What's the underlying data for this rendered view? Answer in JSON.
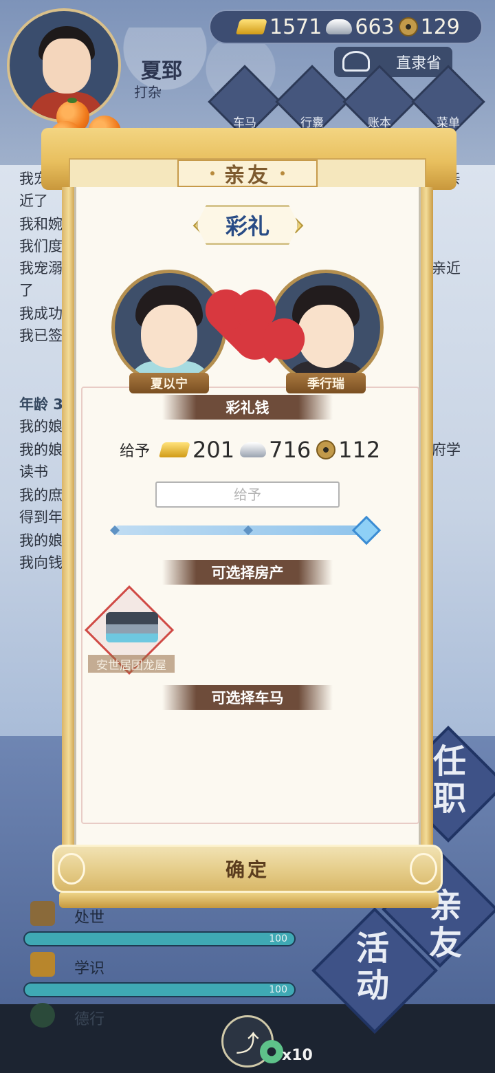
{
  "player": {
    "name": "夏郅",
    "role": "打杂"
  },
  "currency": {
    "gold": "1571",
    "silver": "663",
    "copper": "129"
  },
  "location": "直隶省",
  "nav": {
    "tabs": [
      "车马",
      "行囊",
      "账本",
      "菜单"
    ]
  },
  "background_log": {
    "lines_left": [
      "我宠",
      "近了",
      "我和婉",
      "我们度",
      "我宠溺",
      "了",
      "我成功",
      "我已签",
      "",
      "年龄 3",
      "我的娘",
      "我的娘",
      "读书",
      "我的庶",
      "得到年",
      "我的娘",
      "我向钱"
    ],
    "lines_right": [
      "得亲",
      "亲近",
      "府学"
    ]
  },
  "stats": [
    {
      "label": "处世",
      "value": "100"
    },
    {
      "label": "学识",
      "value": "100"
    },
    {
      "label": "德行",
      "value": ""
    }
  ],
  "side_badges": [
    "任职",
    "亲友",
    "活动"
  ],
  "bottom": {
    "count": "x10"
  },
  "modal": {
    "title": "亲友",
    "heading": "彩礼",
    "bride_name": "夏以宁",
    "groom_name": "季行瑞",
    "money_section": "彩礼钱",
    "give_label": "给予",
    "give_gold": "201",
    "give_silver": "716",
    "give_copper": "112",
    "input_placeholder": "给予",
    "slider_fraction": 1.0,
    "property_section": "可选择房产",
    "property_items": [
      "安世居团龙屋"
    ],
    "carriage_section": "可选择车马",
    "confirm": "确定"
  }
}
